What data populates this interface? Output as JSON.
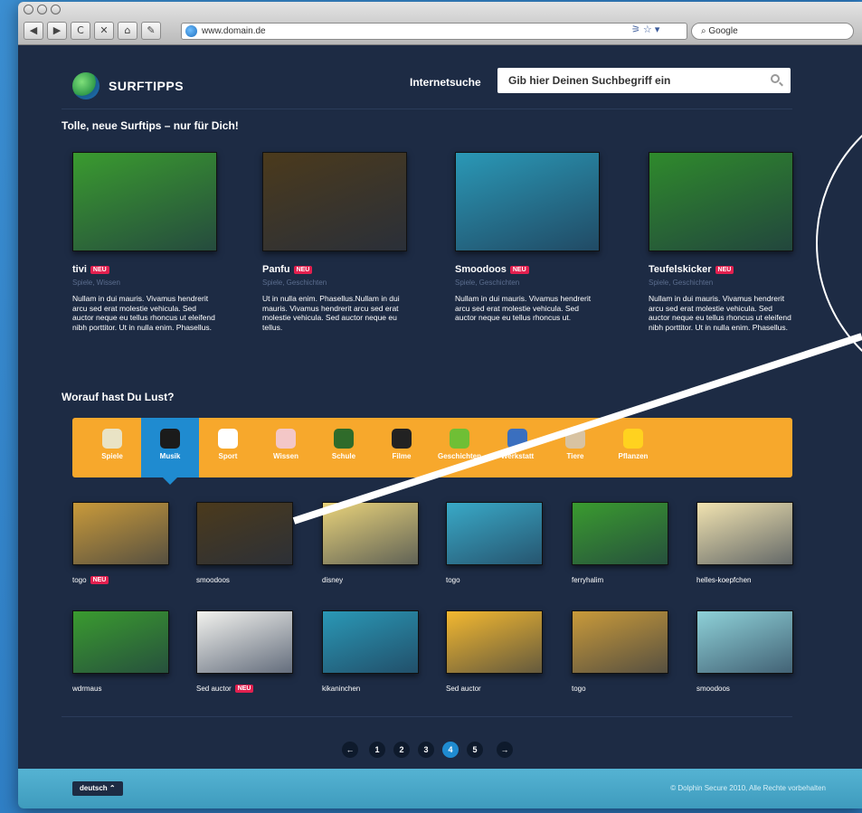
{
  "browser": {
    "url": "www.domain.de",
    "search_placeholder": "Google",
    "nav": [
      "◀",
      "▶",
      "C",
      "✕",
      "⌂",
      "✎"
    ],
    "icons": "⚞ ☆ ▾"
  },
  "header": {
    "logo": "SURFTIPPS",
    "search_label": "Internetsuche",
    "search_placeholder": "Gib hier Deinen Suchbegriff ein"
  },
  "featured": {
    "title": "Tolle, neue Surftips – nur für Dich!",
    "items": [
      {
        "name": "tivi",
        "badge": "NEU",
        "cats": "Spiele, Wissen",
        "desc": "Nullam in dui mauris. Vivamus hendrerit arcu sed erat molestie vehicula. Sed auctor neque eu tellus rhoncus ut eleifend nibh porttitor. Ut in nulla enim. Phasellus.",
        "color": "#3a9b2f"
      },
      {
        "name": "Panfu",
        "badge": "NEU",
        "cats": "Spiele, Geschichten",
        "desc": "Ut in nulla enim. Phasellus.Nullam in dui mauris. Vivamus hendrerit arcu sed erat molestie vehicula. Sed auctor neque eu tellus.",
        "color": "#4b3a1c"
      },
      {
        "name": "Smoodoos",
        "badge": "NEU",
        "cats": "Spiele, Geschichten",
        "desc": "Nullam in dui mauris. Vivamus hendrerit arcu sed erat molestie vehicula. Sed auctor neque eu tellus rhoncus ut.",
        "color": "#2a98b6"
      },
      {
        "name": "Teufelskicker",
        "badge": "NEU",
        "cats": "Spiele, Geschichten",
        "desc": "Nullam in dui mauris. Vivamus hendrerit arcu sed erat molestie vehicula. Sed auctor neque eu tellus rhoncus ut eleifend nibh porttitor. Ut in nulla enim. Phasellus.",
        "color": "#2f8a2c"
      }
    ]
  },
  "categories": {
    "title": "Worauf hast Du Lust?",
    "items": [
      {
        "label": "Spiele",
        "icon": "gamepad-icon",
        "color": "#e9e3c5"
      },
      {
        "label": "Musik",
        "icon": "music-note-icon",
        "color": "#1b1b1b"
      },
      {
        "label": "Sport",
        "icon": "soccer-ball-icon",
        "color": "#ffffff"
      },
      {
        "label": "Wissen",
        "icon": "brain-icon",
        "color": "#f3c7c7"
      },
      {
        "label": "Schule",
        "icon": "chalkboard-icon",
        "color": "#2f6b2a"
      },
      {
        "label": "Filme",
        "icon": "clapperboard-icon",
        "color": "#222222"
      },
      {
        "label": "Geschichten",
        "icon": "frog-icon",
        "color": "#6fbf35"
      },
      {
        "label": "Werkstatt",
        "icon": "gear-icon",
        "color": "#3a6fbf"
      },
      {
        "label": "Tiere",
        "icon": "animal-face-icon",
        "color": "#d8c3a2"
      },
      {
        "label": "Pflanzen",
        "icon": "sunflower-icon",
        "color": "#ffd21f"
      }
    ],
    "active": "Musik"
  },
  "grid": {
    "rows": [
      [
        {
          "name": "togo",
          "badge": "NEU",
          "color": "#c99a3a"
        },
        {
          "name": "smoodoos",
          "badge": "",
          "color": "#4b3a1c"
        },
        {
          "name": "disney",
          "badge": "",
          "color": "#e8d27a"
        },
        {
          "name": "togo",
          "badge": "",
          "color": "#39a9c7"
        },
        {
          "name": "ferryhalim",
          "badge": "",
          "color": "#3a9b2f"
        },
        {
          "name": "helles-koepfchen",
          "badge": "",
          "color": "#f1e3b0"
        }
      ],
      [
        {
          "name": "wdrmaus",
          "badge": "",
          "color": "#3a9b2f"
        },
        {
          "name": "Sed auctor",
          "badge": "NEU",
          "color": "#f2f2ee"
        },
        {
          "name": "kikaninchen",
          "badge": "",
          "color": "#2a98b6"
        },
        {
          "name": "Sed auctor",
          "badge": "",
          "color": "#f3b830"
        },
        {
          "name": "togo",
          "badge": "",
          "color": "#c99a3a"
        },
        {
          "name": "smoodoos",
          "badge": "",
          "color": "#8ed1d8"
        }
      ]
    ]
  },
  "pager": {
    "prev": "←",
    "next": "→",
    "pages": [
      "1",
      "2",
      "3",
      "4",
      "5"
    ],
    "current": "4"
  },
  "footer": {
    "language": "deutsch ⌃",
    "copyright": "© Dolphin Secure 2010, Alle Rechte vorbehalten"
  }
}
